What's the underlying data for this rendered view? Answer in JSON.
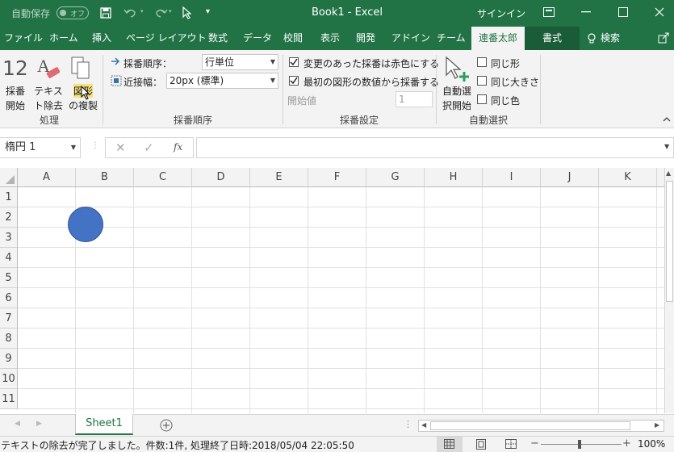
{
  "titlebar": {
    "autosave_label": "自動保存",
    "autosave_state": "オフ",
    "title": "Book1 - Excel",
    "signin": "サインイン",
    "more_icon": "quick-access-more"
  },
  "tabs": [
    "ファイル",
    "ホーム",
    "挿入",
    "ページ レイアウト",
    "数式",
    "データ",
    "校閲",
    "表示",
    "開発",
    "アドイン",
    "チーム",
    "連番太郎",
    "書式"
  ],
  "search_label": "検索",
  "ribbon": {
    "group_process": {
      "label": "処理",
      "number_icon_text": "12",
      "btn_start_line1": "採番",
      "btn_start_line2": "開始",
      "btn_textdel_line1": "テキス",
      "btn_textdel_line2": "ト除去",
      "btn_copy_line1": "図形",
      "btn_copy_line2": "の複製"
    },
    "group_order": {
      "label": "採番順序",
      "order_label": "採番順序：",
      "order_value": "行単位",
      "width_label": "近接幅：",
      "width_value": "20px (標準)"
    },
    "group_settings": {
      "label": "採番設定",
      "chk_red": "変更のあった採番は赤色にする",
      "chk_red_checked": true,
      "chk_first": "最初の図形の数値から採番する",
      "chk_first_checked": true,
      "start_label": "開始値",
      "start_value": "1"
    },
    "group_auto": {
      "label": "自動選択",
      "btn_line1": "自動選",
      "btn_line2": "択開始",
      "chk_shape": "同じ形",
      "chk_size": "同じ大きさ",
      "chk_color": "同じ色"
    }
  },
  "formula_bar": {
    "name_box": "楕円 1",
    "fx": "fx",
    "content": ""
  },
  "grid": {
    "columns": [
      "A",
      "B",
      "C",
      "D",
      "E",
      "F",
      "G",
      "H",
      "I",
      "J",
      "K"
    ],
    "rows": [
      "1",
      "2",
      "3",
      "4",
      "5",
      "6",
      "7",
      "8",
      "9",
      "10",
      "11"
    ],
    "shape_color": "#4472c4"
  },
  "sheets": [
    "Sheet1"
  ],
  "status": {
    "message": "テキストの除去が完了しました。件数:1件, 処理終了日時:2018/05/04 22:05:50",
    "zoom": "100%"
  },
  "colors": {
    "excel_green": "#217346",
    "ribbon_bg": "#f3f3f3"
  }
}
